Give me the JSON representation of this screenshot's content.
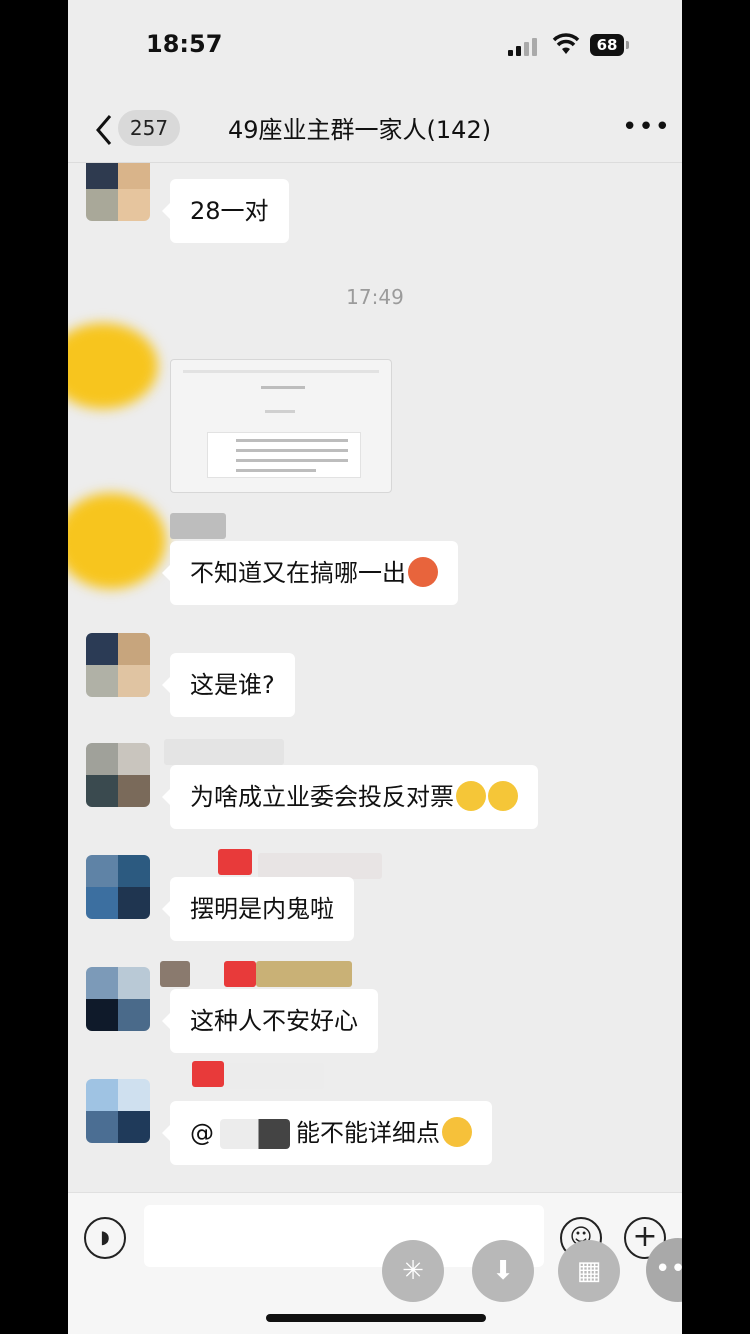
{
  "status_bar": {
    "time": "18:57",
    "battery": "68"
  },
  "nav": {
    "unread_count": "257",
    "title": "49座业主群一家人(142)",
    "more_label": "•••"
  },
  "chat": {
    "timestamp": "17:49",
    "messages": [
      {
        "text": "28一对"
      },
      {
        "text": "不知道又在搞哪一出",
        "emoji": "angry-face"
      },
      {
        "text": "这是谁?"
      },
      {
        "text": "为啥成立业委会投反对票",
        "emoji": "crying-laughing-face"
      },
      {
        "text": "摆明是内鬼啦"
      },
      {
        "text": "这种人不安好心"
      },
      {
        "text_prefix": "@",
        "text": "能不能详细点",
        "emoji": "kissing-face"
      }
    ]
  },
  "input_bar": {
    "plus_label": "+"
  },
  "colors": {
    "background": "#ededed",
    "bubble": "#ffffff",
    "timestamp": "#9b9b9b"
  }
}
